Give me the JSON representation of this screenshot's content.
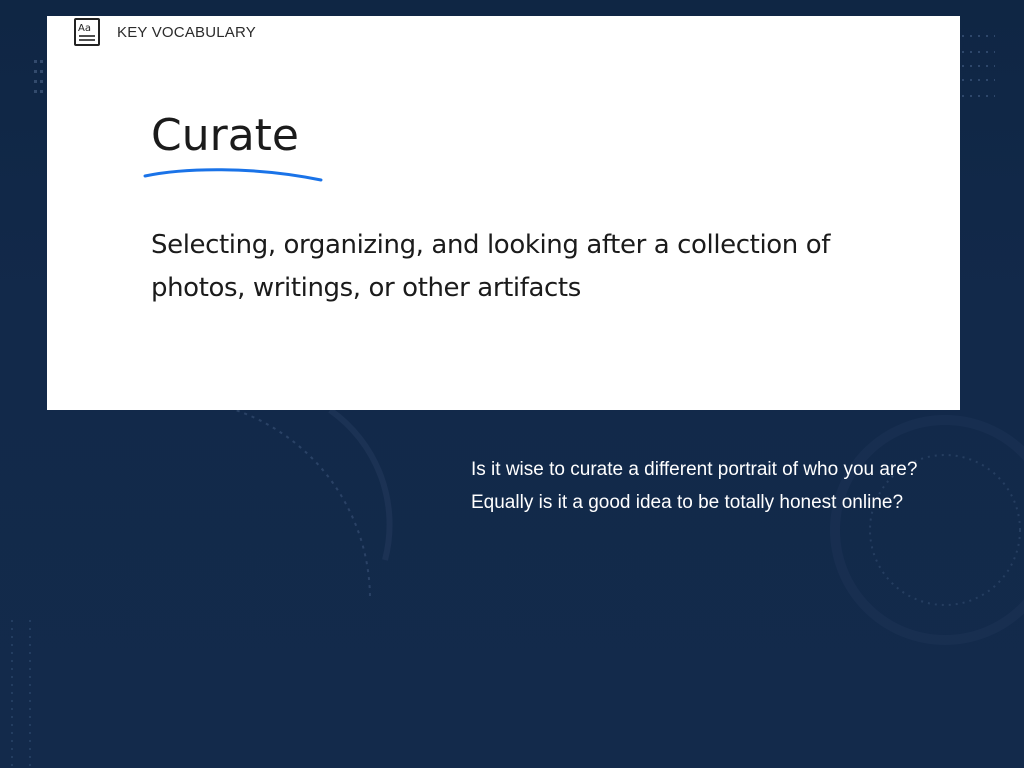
{
  "slide": {
    "header_label": "KEY VOCABULARY",
    "term": "Curate",
    "definition": "Selecting, organizing, and looking after a collection of photos, writings, or other artifacts",
    "questions": [
      "Is it wise to curate a different portrait of who you are?",
      "Equally is it a good idea to be totally honest online?"
    ]
  },
  "icons": {
    "header": "vocabulary-card-icon"
  },
  "colors": {
    "background": "#12294a",
    "card": "#ffffff",
    "underline": "#1a73e8",
    "question_text": "#ffffff"
  }
}
